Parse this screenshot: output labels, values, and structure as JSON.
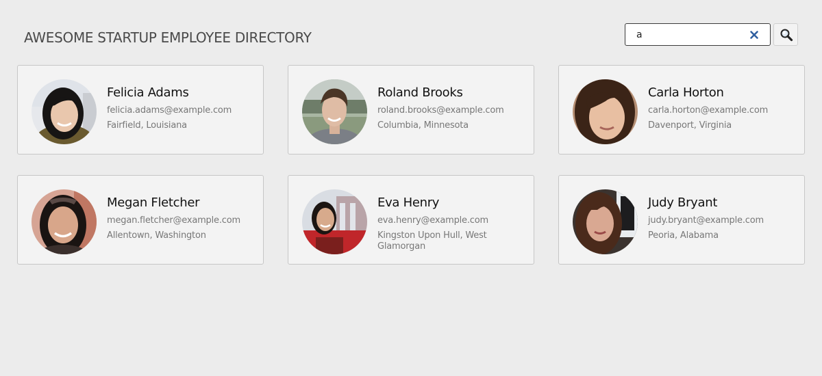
{
  "header": {
    "title": "AWESOME STARTUP EMPLOYEE DIRECTORY"
  },
  "search": {
    "value": "a",
    "clear_icon": "close-icon",
    "button_icon": "search-icon"
  },
  "colors": {
    "background": "#ececec",
    "card_background": "#f3f3f3",
    "clear_icon": "#2f5fa0"
  },
  "employees": [
    {
      "name": "Felicia Adams",
      "email": "felicia.adams@example.com",
      "location": "Fairfield, Louisiana"
    },
    {
      "name": "Roland Brooks",
      "email": "roland.brooks@example.com",
      "location": "Columbia, Minnesota"
    },
    {
      "name": "Carla Horton",
      "email": "carla.horton@example.com",
      "location": "Davenport, Virginia"
    },
    {
      "name": "Megan Fletcher",
      "email": "megan.fletcher@example.com",
      "location": "Allentown, Washington"
    },
    {
      "name": "Eva Henry",
      "email": "eva.henry@example.com",
      "location": "Kingston Upon Hull, West Glamorgan"
    },
    {
      "name": "Judy Bryant",
      "email": "judy.bryant@example.com",
      "location": "Peoria, Alabama"
    }
  ]
}
